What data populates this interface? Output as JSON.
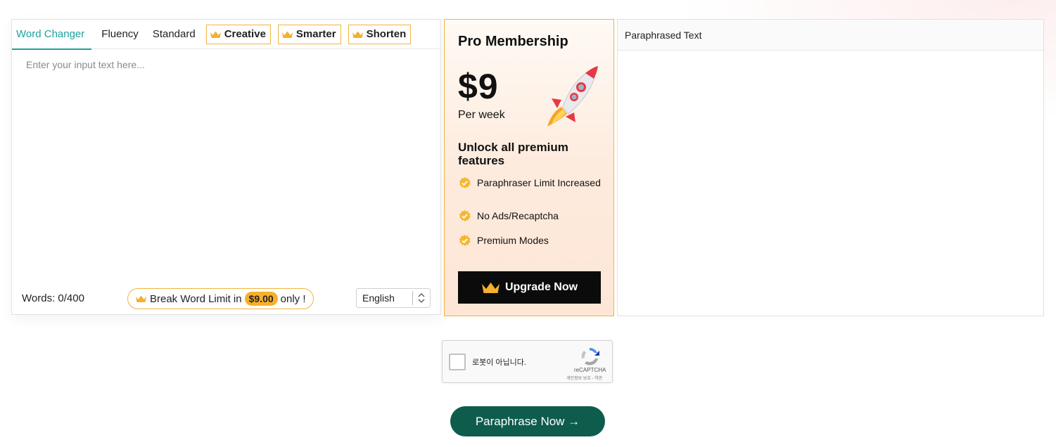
{
  "tabs": [
    {
      "label": "Word Changer",
      "active": true,
      "premium": false
    },
    {
      "label": "Fluency",
      "active": false,
      "premium": false
    },
    {
      "label": "Standard",
      "active": false,
      "premium": false
    },
    {
      "label": "Creative",
      "active": false,
      "premium": true
    },
    {
      "label": "Smarter",
      "active": false,
      "premium": true
    },
    {
      "label": "Shorten",
      "active": false,
      "premium": true
    }
  ],
  "input": {
    "placeholder": "Enter your input text here...",
    "value": ""
  },
  "footer": {
    "word_count": "Words: 0/400",
    "break_prefix": "Break Word Limit in",
    "break_price": "$9.00",
    "break_suffix": "only !",
    "language": "English"
  },
  "pro": {
    "title": "Pro Membership",
    "price": "$9",
    "period": "Per week",
    "unlock": "Unlock all premium features",
    "features": [
      "Paraphraser Limit Increased",
      "No Ads/Recaptcha",
      "Premium Modes"
    ],
    "upgrade_label": "Upgrade Now"
  },
  "output": {
    "title": "Paraphrased Text"
  },
  "recaptcha": {
    "label": "로봇이 아닙니다.",
    "brand": "reCAPTCHA",
    "terms": "개인정보 보호 - 약관"
  },
  "action": {
    "paraphrase_label": "Paraphrase Now →"
  },
  "colors": {
    "accent": "#1ba39c",
    "gold": "#f2b33d",
    "button_dark": "#0b0b0b",
    "paraphrase_green": "#0d5c4c"
  }
}
